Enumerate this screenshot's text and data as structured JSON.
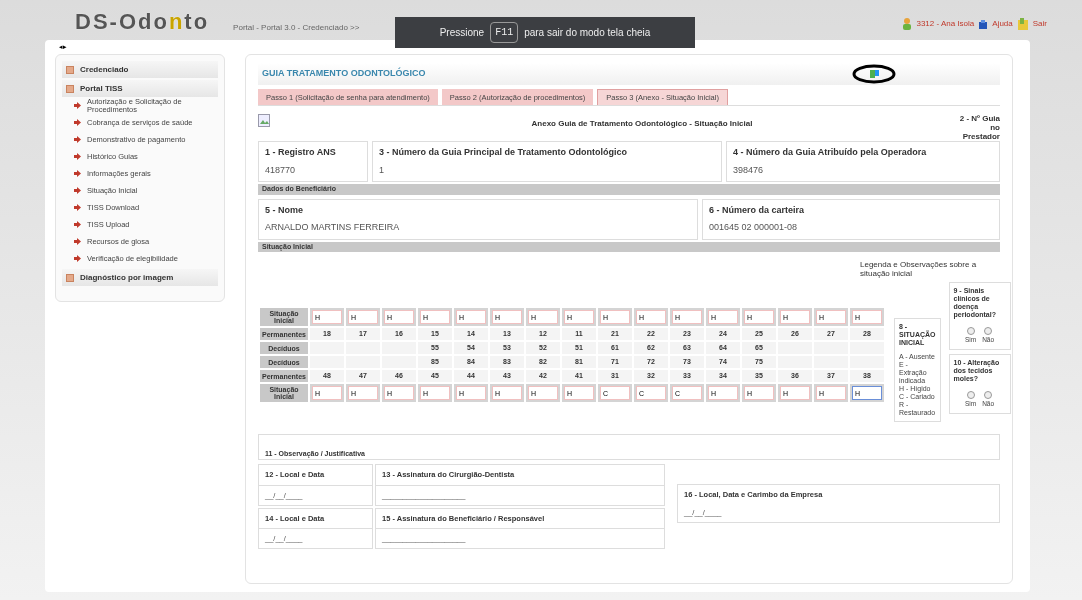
{
  "header": {
    "logo": [
      "DS-Odo",
      "n",
      "to"
    ],
    "breadcrumb": "Portal - Portal 3.0 - Credenciado >>",
    "user": "3312 - Ana Isola",
    "help": "Ajuda",
    "exit": "Sair"
  },
  "toast": {
    "before": "Pressione",
    "key": "F11",
    "after": "para sair do modo tela cheia"
  },
  "collapse_toggle": "◂▸",
  "sidebar": [
    {
      "label": "Credenciado"
    },
    {
      "label": "Portal TISS",
      "children": [
        "Autorização e Solicitação de Procedimentos",
        "Cobrança de serviços de saúde",
        "Demonstrativo de pagamento",
        "Histórico Guias",
        "Informações gerais",
        "Situação Inicial",
        "TISS Download",
        "TISS Upload",
        "Recursos de glosa",
        "Verificação de elegibilidade"
      ]
    },
    {
      "label": "Diagnóstico por imagem"
    }
  ],
  "form": {
    "title": "GUIA TRATAMENTO ODONTOLÓGICO",
    "tabs": [
      {
        "label": "Passo 1 (Solicitação de senha para atendimento)",
        "selected": false
      },
      {
        "label": "Passo 2 (Autorização de procedimentos)",
        "selected": false
      },
      {
        "label": "Passo 3 (Anexo - Situação Inicial)",
        "selected": true
      }
    ],
    "doc_title": "Anexo Guia de Tratamento Odontológico - Situação Inicial",
    "guide_no": "2 - Nº Guia no Prestador",
    "fields_top": [
      {
        "label": "1 - Registro ANS",
        "value": "418770"
      },
      {
        "label": "3 - Número da Guia Principal de Tratamento Odontológico",
        "value": "1"
      },
      {
        "label": "4 - Número da Guia Atribuído pela Operadora",
        "value": "398476"
      }
    ],
    "beneficiary_section": "Dados do Beneficiário",
    "fields_beneficiary": [
      {
        "label": "5 - Nome",
        "value": "ARNALDO MARTINS FERREIRA"
      },
      {
        "label": "6 - Número da carteira",
        "value": "001645 02 000001-08"
      }
    ],
    "situation_section": "Situação Inicial",
    "legend_title": "Legenda e Observações sobre a situação inicial",
    "teeth_rows": [
      {
        "kind": "input",
        "label": "Situação Inicial",
        "cells": [
          {
            "value": "H",
            "focused": false
          },
          {
            "value": "H",
            "focused": false
          },
          {
            "value": "H",
            "focused": false
          },
          {
            "value": "H",
            "focused": false
          },
          {
            "value": "H",
            "focused": false
          },
          {
            "value": "H",
            "focused": false
          },
          {
            "value": "H",
            "focused": false
          },
          {
            "value": "H",
            "focused": false
          },
          {
            "value": "H",
            "focused": false
          },
          {
            "value": "H",
            "focused": false
          },
          {
            "value": "H",
            "focused": false
          },
          {
            "value": "H",
            "focused": false
          },
          {
            "value": "H",
            "focused": false
          },
          {
            "value": "H",
            "focused": false
          },
          {
            "value": "H",
            "focused": false
          },
          {
            "value": "H",
            "focused": false
          }
        ]
      },
      {
        "kind": "numbers",
        "label": "Permanentes",
        "cells": [
          "18",
          "17",
          "16",
          "15",
          "14",
          "13",
          "12",
          "11",
          "21",
          "22",
          "23",
          "24",
          "25",
          "26",
          "27",
          "28"
        ]
      },
      {
        "kind": "numbers",
        "label": "Decíduos",
        "cells": [
          null,
          null,
          null,
          "55",
          "54",
          "53",
          "52",
          "51",
          "61",
          "62",
          "63",
          "64",
          "65",
          null,
          null,
          null
        ]
      },
      {
        "kind": "numbers",
        "label": "Decíduos",
        "cells": [
          null,
          null,
          null,
          "85",
          "84",
          "83",
          "82",
          "81",
          "71",
          "72",
          "73",
          "74",
          "75",
          null,
          null,
          null
        ]
      },
      {
        "kind": "numbers",
        "label": "Permanentes",
        "cells": [
          "48",
          "47",
          "46",
          "45",
          "44",
          "43",
          "42",
          "41",
          "31",
          "32",
          "33",
          "34",
          "35",
          "36",
          "37",
          "38"
        ]
      },
      {
        "kind": "input",
        "label": "Situação Inicial",
        "cells": [
          {
            "value": "H",
            "focused": false
          },
          {
            "value": "H",
            "focused": false
          },
          {
            "value": "H",
            "focused": false
          },
          {
            "value": "H",
            "focused": false
          },
          {
            "value": "H",
            "focused": false
          },
          {
            "value": "H",
            "focused": false
          },
          {
            "value": "H",
            "focused": false
          },
          {
            "value": "H",
            "focused": false
          },
          {
            "value": "C",
            "focused": false
          },
          {
            "value": "C",
            "focused": false
          },
          {
            "value": "C",
            "focused": false
          },
          {
            "value": "H",
            "focused": false
          },
          {
            "value": "H",
            "focused": false
          },
          {
            "value": "H",
            "focused": false
          },
          {
            "value": "H",
            "focused": false
          },
          {
            "value": "H",
            "focused": true
          }
        ]
      }
    ],
    "legend_box": {
      "title": "8 - SITUAÇÃO INICIAL",
      "items": [
        "A - Ausente",
        "E - Extração indicada",
        "H - Hígido",
        "C - Cariado",
        "R - Restaurado"
      ]
    },
    "questions": [
      {
        "label": "9 - Sinais clínicos de doença periodontal?",
        "options": [
          {
            "label": "Sim",
            "selected": false
          },
          {
            "label": "Não",
            "selected": false
          }
        ]
      },
      {
        "label": "10 - Alteração dos tecidos moles?",
        "options": [
          {
            "label": "Sim",
            "selected": false
          },
          {
            "label": "Não",
            "selected": false
          }
        ]
      }
    ],
    "observation": "11 - Observação / Justificativa",
    "signatures": [
      {
        "label": "12 - Local e Data",
        "value": "__/__/____"
      },
      {
        "label": "13 - Assinatura do Cirurgião-Dentista",
        "value": "____________________"
      },
      {
        "label": "14 - Local e Data",
        "value": "__/__/____"
      },
      {
        "label": "15 - Assinatura do Beneficiário / Responsável",
        "value": "____________________"
      }
    ],
    "company": {
      "label": "16 - Local, Data e Carimbo da Empresa",
      "value": "__/__/____"
    }
  }
}
